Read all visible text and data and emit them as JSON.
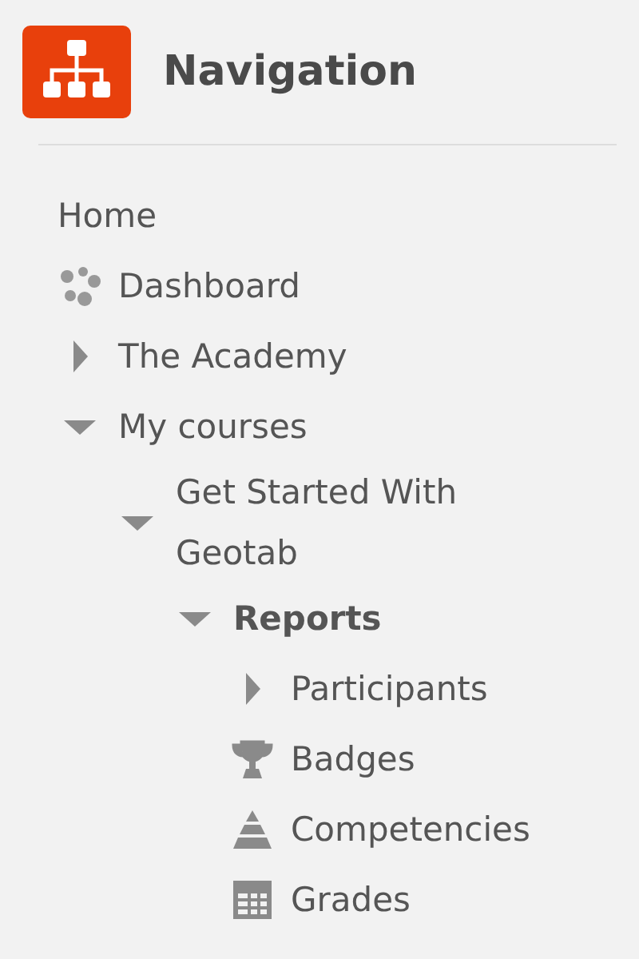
{
  "header": {
    "title": "Navigation"
  },
  "tree": [
    {
      "label": "Home",
      "kind": "plain",
      "active": false
    },
    {
      "label": "Dashboard",
      "kind": "dashboard",
      "active": false
    },
    {
      "label": "The Academy",
      "kind": "branch",
      "expanded": false,
      "active": false
    },
    {
      "label": "My courses",
      "kind": "branch",
      "expanded": true,
      "active": false,
      "children": [
        {
          "label": "Get Started With Geotab",
          "kind": "branch",
          "expanded": true,
          "active": false,
          "children": [
            {
              "label": "Reports",
              "kind": "branch",
              "expanded": true,
              "active": true,
              "children": [
                {
                  "label": "Participants",
                  "kind": "branch",
                  "expanded": false,
                  "active": false
                },
                {
                  "label": "Badges",
                  "kind": "trophy",
                  "active": false
                },
                {
                  "label": "Competencies",
                  "kind": "pyramid",
                  "active": false
                },
                {
                  "label": "Grades",
                  "kind": "table",
                  "active": false
                }
              ]
            }
          ]
        }
      ]
    }
  ]
}
